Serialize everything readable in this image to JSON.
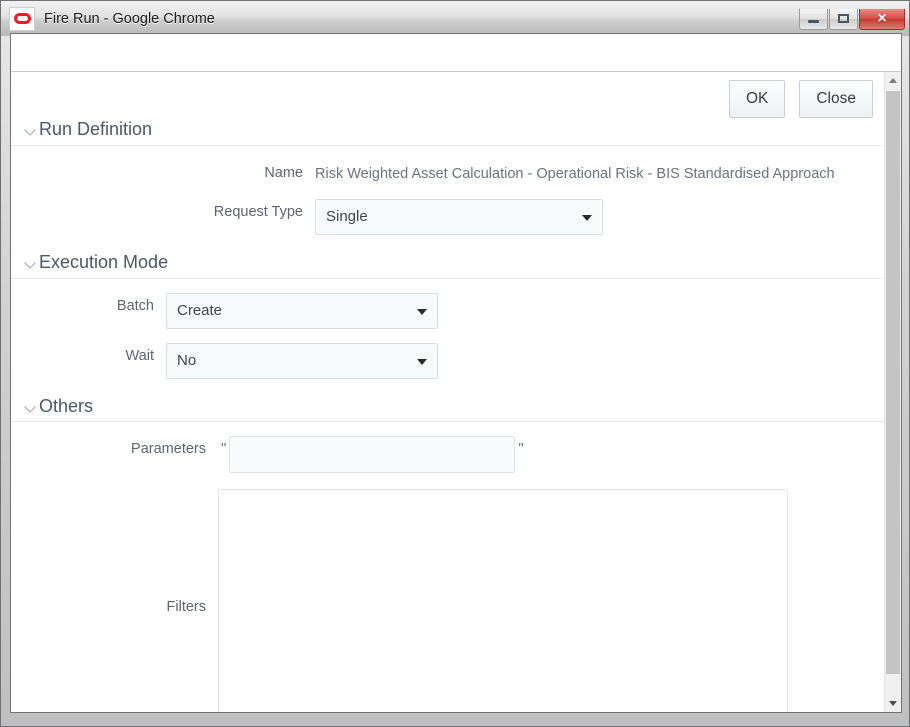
{
  "window": {
    "title": "Fire Run - Google Chrome",
    "logo_icon": "oracle-logo-icon",
    "minimize_label": "",
    "maximize_label": "",
    "close_label": "×"
  },
  "toolbar": {
    "ok_label": "OK",
    "close_label": "Close"
  },
  "sections": {
    "run_definition": {
      "title": "Run Definition",
      "name_label": "Name",
      "name_value": "Risk Weighted Asset Calculation - Operational Risk - BIS Standardised Approach",
      "request_type_label": "Request Type",
      "request_type_value": "Single"
    },
    "execution_mode": {
      "title": "Execution Mode",
      "batch_label": "Batch",
      "batch_value": "Create",
      "wait_label": "Wait",
      "wait_value": "No"
    },
    "others": {
      "title": "Others",
      "parameters_label": "Parameters",
      "parameters_value": "",
      "parameters_placeholder": "",
      "quote_open": "\"",
      "quote_close": "\"",
      "filters_label": "Filters",
      "filters_value": "",
      "filters_placeholder": ""
    }
  },
  "colors": {
    "accent_red": "#ee1c25",
    "section_title": "#4a5766",
    "label": "#5c6570",
    "value": "#6b737d"
  }
}
